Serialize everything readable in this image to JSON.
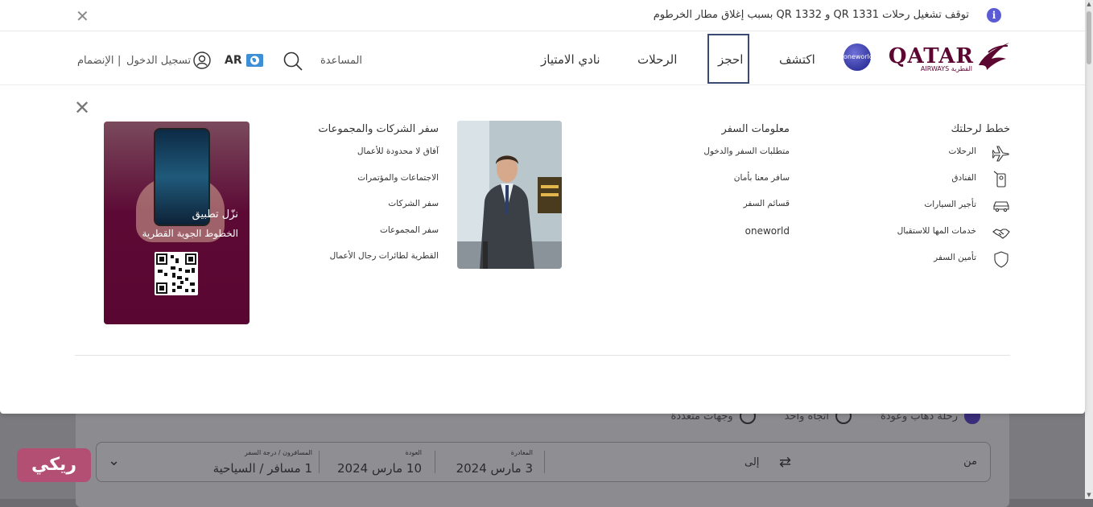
{
  "alert": {
    "text": "توقف تشغيل رحلات QR 1331 و QR 1332 بسبب إغلاق مطار الخرطوم",
    "close_icon": "close-icon",
    "info_icon_glyph": "i"
  },
  "header": {
    "logo_word": "QATAR",
    "logo_sub": "AIRWAYS القطرية",
    "oneworld_label": "oneworld",
    "nav": {
      "explore": "اكتشف",
      "book": "احجز",
      "flights": "الرحلات",
      "privilege": "نادي الامتياز"
    },
    "help": "المساعدة",
    "language": "AR",
    "login": "تسجيل الدخول",
    "separator": "|",
    "join": "الإنضمام"
  },
  "menu": {
    "plan": {
      "title": "خطط لرحلتك",
      "items": [
        {
          "label": "الرحلات",
          "icon": "plane-icon"
        },
        {
          "label": "الفنادق",
          "icon": "hotel-key-icon"
        },
        {
          "label": "تأجير السيارات",
          "icon": "car-icon"
        },
        {
          "label": "خدمات المها للاستقبال",
          "icon": "handshake-icon"
        },
        {
          "label": "تأمين السفر",
          "icon": "shield-icon"
        }
      ]
    },
    "travel_info": {
      "title": "معلومات السفر",
      "items": [
        "متطلبات السفر والدخول",
        "سافر معنا بأمان",
        "قسائم السفر",
        "oneworld"
      ]
    },
    "corporate": {
      "title": "سفر الشركات والمجموعات",
      "items": [
        "آفاق لا محدودة للأعمال",
        "الاجتماعات والمؤتمرات",
        "سفر الشركات",
        "سفر المجموعات",
        "القطرية لطائرات رجال الأعمال"
      ]
    },
    "app": {
      "line1": "نزّل تطبيق",
      "line2": "الخطوط الجوية القطرية"
    }
  },
  "background_form": {
    "trip_types": [
      "رحلة ذهاب وعودة",
      "اتجاه واحد",
      "وجهات متعددة"
    ],
    "from": "من",
    "to": "إلى",
    "departure_label": "المغادرة",
    "departure_value": "3 مارس 2024",
    "return_label": "العودة",
    "return_value": "10 مارس 2024",
    "passengers_label": "المسافرون / درجة السفر",
    "passengers_value": "1 مسافر / السياحية"
  },
  "watermark": "ريكي",
  "colors": {
    "brand": "#5c0632",
    "nav_active_border": "#3a4a73",
    "info": "#5b5bd6"
  }
}
